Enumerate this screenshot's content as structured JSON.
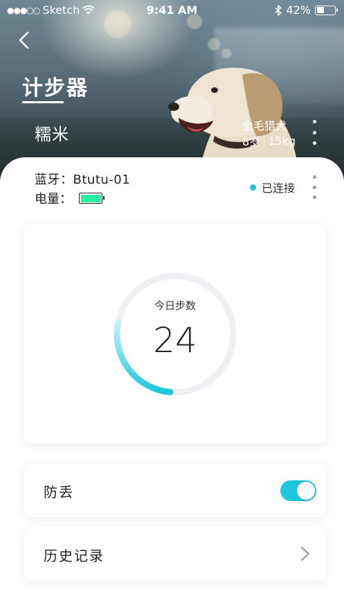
{
  "status_bar": {
    "signal_dots": "●●●○○",
    "carrier": "Sketch",
    "time": "9:41 AM",
    "battery_percent": "42%",
    "battery_level": 0.42,
    "icons": [
      "wifi-icon",
      "bluetooth-icon",
      "battery-icon"
    ]
  },
  "header": {
    "title": "计步器",
    "pet_name": "糯米",
    "breed": "金毛猎犬",
    "age": "8岁",
    "weight": "15kg"
  },
  "device": {
    "bluetooth_label": "蓝牙：Btutu-01",
    "battery_label": "电量：",
    "battery_level": 1.0,
    "battery_color": "#28f0a0",
    "status": "已连接",
    "status_color": "#1ec8dc"
  },
  "steps": {
    "label": "今日步数",
    "value": "24",
    "progress_fraction": 0.27,
    "accent_color": "#1ec8dc",
    "track_color": "#eef0f4"
  },
  "anti_lost": {
    "label": "防丢",
    "enabled": true
  },
  "history": {
    "label": "历史记录"
  }
}
